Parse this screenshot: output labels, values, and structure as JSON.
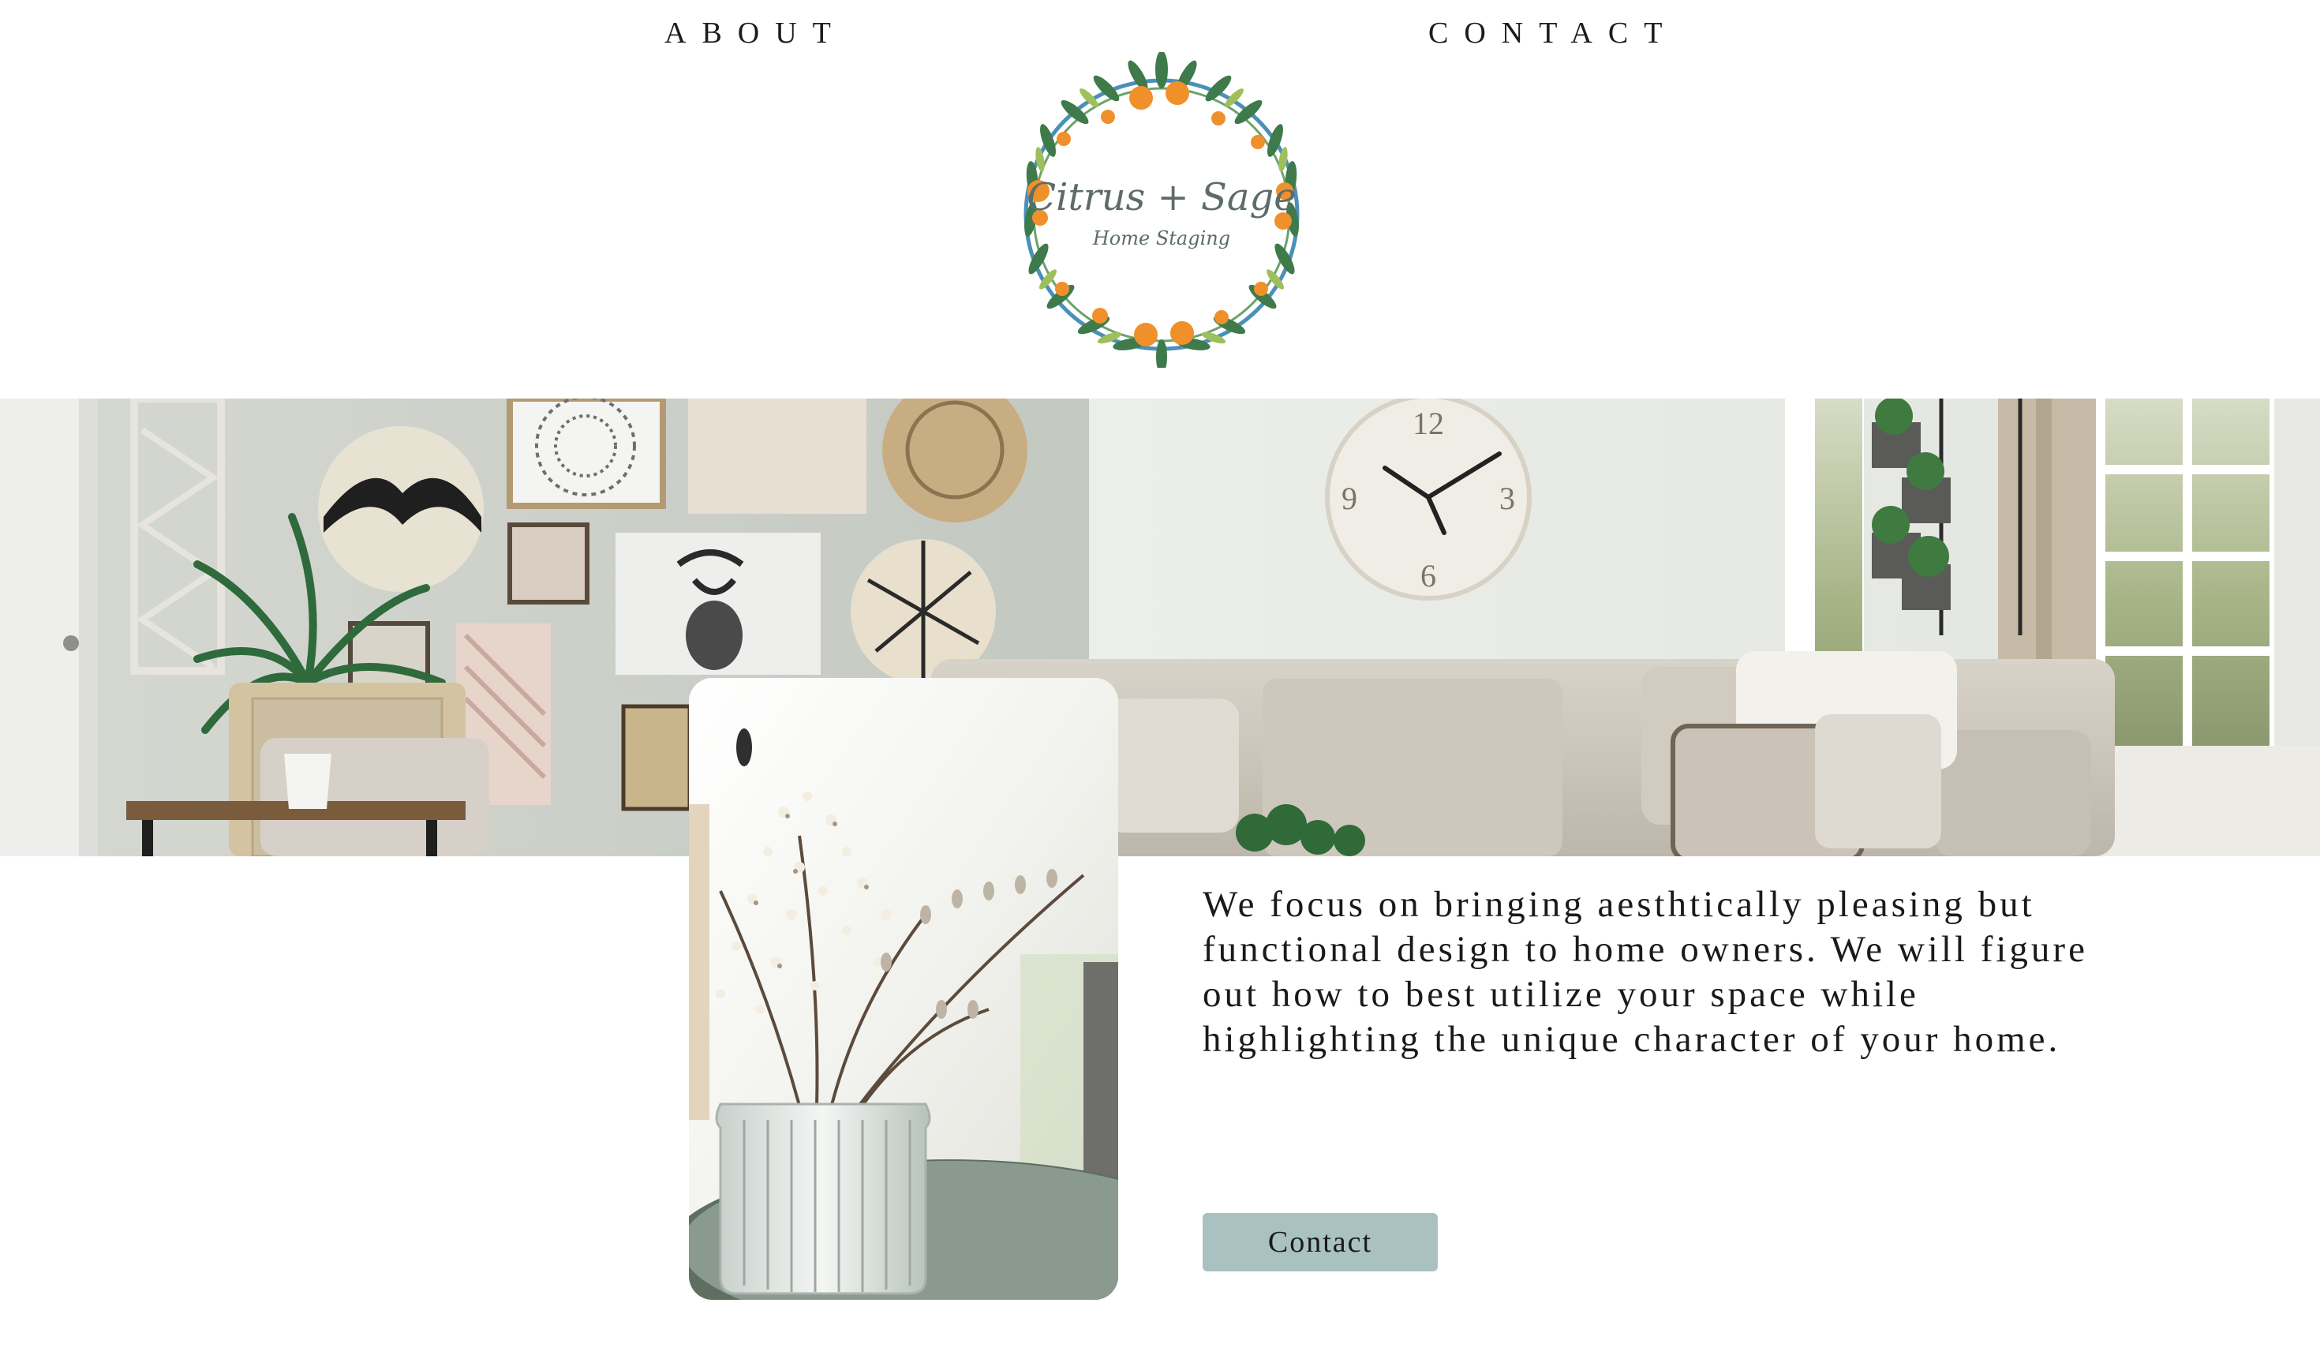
{
  "nav": {
    "about_label": "ABOUT",
    "contact_label": "CONTACT"
  },
  "logo": {
    "brand_name": "Citrus + Sage",
    "tagline": "Home Staging"
  },
  "intro": {
    "text": "We focus on bringing aesthtically pleasing but functional design to home owners. We will figure out how to best utilize your space while highlighting the unique character of your home."
  },
  "cta": {
    "label": "Contact"
  },
  "colors": {
    "button_bg": "#a9c1c1",
    "text": "#1a1a1a",
    "wreath_leaf": "#3f7a4a",
    "wreath_orange": "#f0902a",
    "wreath_ring": "#4a90b8",
    "logo_text": "#5d6b6b"
  }
}
